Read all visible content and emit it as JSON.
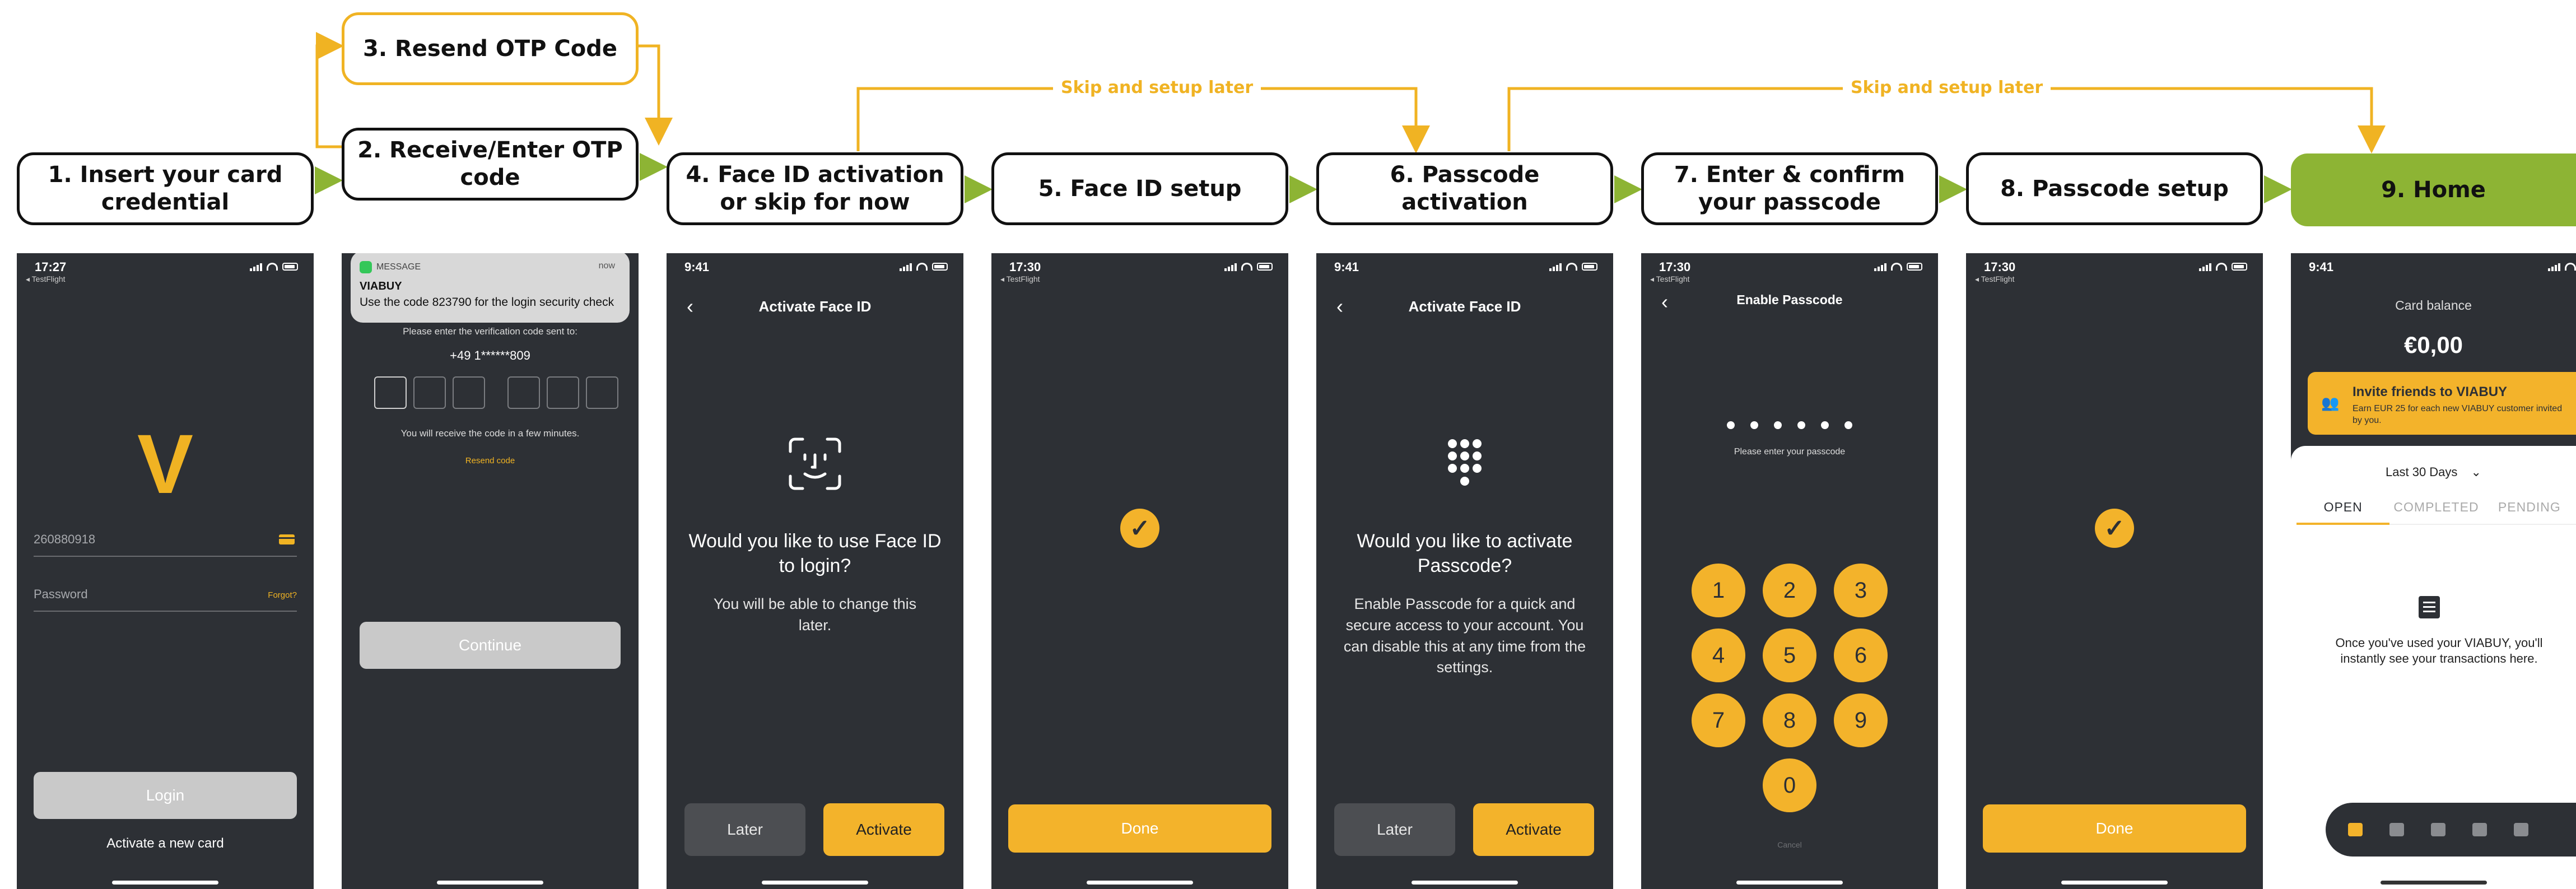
{
  "steps": {
    "s1": "1. Insert your card credential",
    "s2": "2. Receive/Enter OTP code",
    "s3": "3. Resend OTP Code",
    "s4": "4. Face ID activation or skip for now",
    "s5": "5. Face ID setup",
    "s6": "6. Passcode activation",
    "s7": "7. Enter & confirm your passcode",
    "s8": "8. Passcode setup",
    "s9": "9. Home"
  },
  "skip_label_1": "Skip and setup later",
  "skip_label_2": "Skip and setup later",
  "colors": {
    "accent": "#f0b323",
    "flow_arrow": "#8db434",
    "screen_bg": "#2d3035",
    "home_step": "#8db434"
  },
  "screen1": {
    "time": "17:27",
    "testflight": "◂ TestFlight",
    "logo": "V",
    "card_number": "260880918",
    "password_placeholder": "Password",
    "forgot": "Forgot?",
    "login": "Login",
    "activate_card": "Activate a new card"
  },
  "screen2": {
    "notif_app": "MESSAGE",
    "notif_time": "now",
    "notif_title": "VIABUY",
    "notif_body": "Use the code 823790 for the login security check",
    "instruction": "Please enter the verification code sent to:",
    "phone": "+49 1******809",
    "receive_note": "You will receive the code in a few minutes.",
    "resend": "Resend code",
    "continue": "Continue"
  },
  "screen3": {
    "time": "9:41",
    "title": "Activate Face ID",
    "question": "Would you like to use Face ID to login?",
    "note": "You will be able to change this later.",
    "later": "Later",
    "activate": "Activate"
  },
  "screen4": {
    "time": "17:30",
    "testflight": "◂ TestFlight",
    "done": "Done"
  },
  "screen5": {
    "time": "9:41",
    "title": "Activate Face ID",
    "question": "Would you like to activate Passcode?",
    "note": "Enable Passcode for a quick and secure access to your account. You can disable this at any time from the settings.",
    "later": "Later",
    "activate": "Activate"
  },
  "screen6": {
    "time": "17:30",
    "testflight": "◂ TestFlight",
    "title": "Enable Passcode",
    "prompt": "Please enter your passcode",
    "keys": [
      "1",
      "2",
      "3",
      "4",
      "5",
      "6",
      "7",
      "8",
      "9",
      "0"
    ],
    "cancel": "Cancel"
  },
  "screen7": {
    "time": "17:30",
    "testflight": "◂ TestFlight",
    "done": "Done"
  },
  "screen8": {
    "time": "9:41",
    "balance_label": "Card balance",
    "balance": "€0,00",
    "invite_title": "Invite friends to VIABUY",
    "invite_body": "Earn EUR 25 for each new VIABUY customer invited by you.",
    "period": "Last 30 Days",
    "tab_open": "OPEN",
    "tab_completed": "COMPLETED",
    "tab_pending": "PENDING",
    "empty": "Once you've used your VIABUY, you'll instantly see your transactions here."
  },
  "icons": {
    "card": "card-icon",
    "faceid": "face-id-icon",
    "check": "checkmark-icon",
    "keypad": "keypad-icon",
    "back": "chevron-left-icon",
    "invite": "people-icon",
    "receipt": "receipt-icon"
  }
}
